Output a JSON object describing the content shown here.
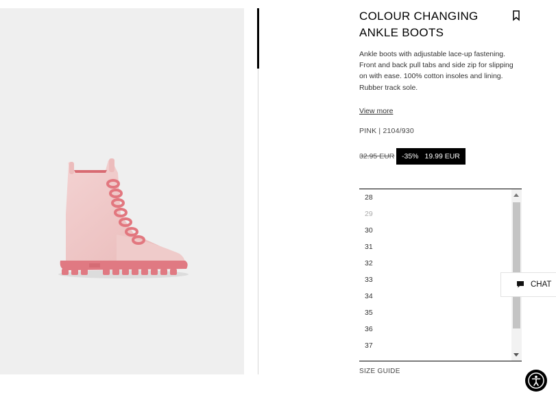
{
  "product": {
    "title": "COLOUR CHANGING ANKLE BOOTS",
    "description": "Ankle boots with adjustable lace-up fastening. Front and back pull tabs and side zip for slipping on with ease. 100% cotton insoles and lining. Rubber track sole.",
    "view_more": "View more",
    "reference": "PINK | 2104/930",
    "old_price": "32.95 EUR",
    "discount": "-35%",
    "price": "19.99 EUR",
    "image_alt": "pink-ankle-boot"
  },
  "sizes": {
    "options": [
      "28",
      "29",
      "30",
      "31",
      "32",
      "33",
      "34",
      "35",
      "36",
      "37"
    ],
    "disabled": [
      "29"
    ],
    "guide_label": "SIZE GUIDE"
  },
  "chat": {
    "label": "CHAT",
    "icon": "chat-bubble-icon"
  },
  "accessibility": {
    "icon": "accessibility-icon"
  },
  "colors": {
    "boot": "#f0c7c6",
    "sole": "#e07982",
    "laces": "#e2777f",
    "sale_bg": "#000000"
  }
}
